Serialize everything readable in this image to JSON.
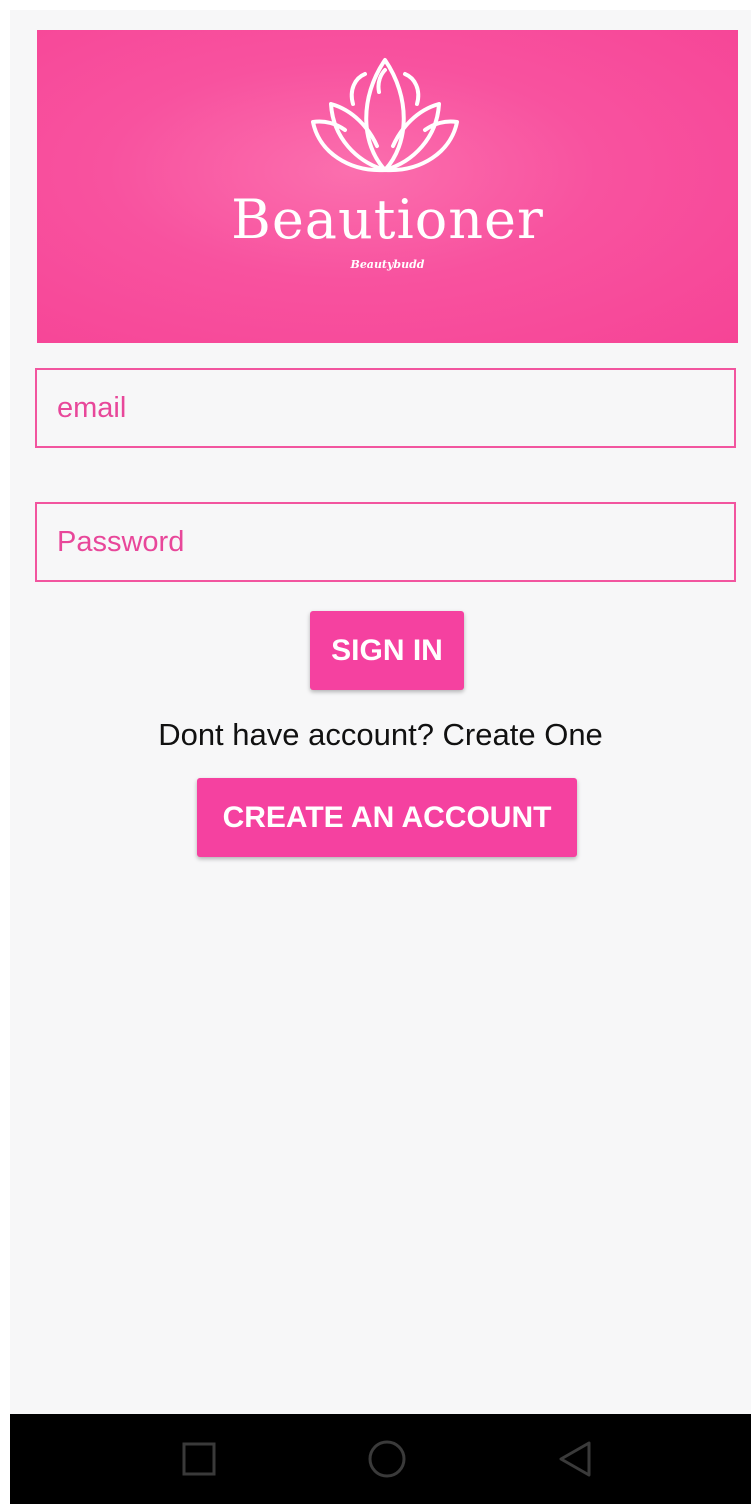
{
  "banner": {
    "brand_name": "Beautioner",
    "tagline": "Beautybudd",
    "background_color": "#f64496",
    "logo_icon": "lotus-icon"
  },
  "form": {
    "email_placeholder": "email",
    "password_placeholder": "Password",
    "sign_in_label": "SIGN IN",
    "prompt_text": "Dont have account? Create One",
    "create_account_label": "CREATE AN ACCOUNT",
    "accent_color": "#f541a0"
  },
  "navbar": {
    "icons": [
      "recents-square-icon",
      "home-circle-icon",
      "back-triangle-icon"
    ]
  }
}
